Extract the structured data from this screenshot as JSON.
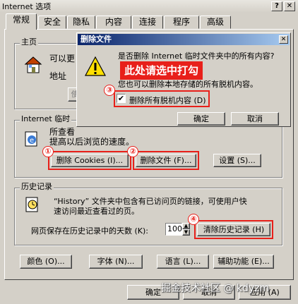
{
  "window": {
    "title": "Internet 选项",
    "help_glyph": "?",
    "close_glyph": "✕"
  },
  "tabs": [
    "常规",
    "安全",
    "隐私",
    "内容",
    "连接",
    "程序",
    "高级"
  ],
  "home": {
    "group_title": "主页",
    "desc": "可以更",
    "address_label": "地址",
    "btn_use_current": "使"
  },
  "temp_files": {
    "group_title": "Internet 临时",
    "desc_line1": "所查看",
    "desc_line2": "提高以后浏览的速度。",
    "btn_delete_cookies": "删除 Cookies (I)...",
    "btn_delete_files": "删除文件 (F)...",
    "btn_settings": "设置 (S)..."
  },
  "history": {
    "group_title": "历史记录",
    "desc_line1": "“History” 文件夹中包含有已访问页的链接，可使用户快",
    "desc_line2": "速访问最近查看过的页。",
    "days_label": "网页保存在历史记录中的天数 (K):",
    "days_value": "100",
    "btn_clear": "清除历史记录 (H)"
  },
  "bottom_buttons": [
    "颜色 (O)...",
    "字体 (N)...",
    "语言 (L)...",
    "辅助功能 (E)..."
  ],
  "footer": {
    "ok": "确定",
    "cancel": "取消",
    "apply": "应用 (A)"
  },
  "dialog": {
    "title": "删除文件",
    "close_glyph": "✕",
    "message_line1": "是否删除 Internet 临时文件夹中的所有内容?",
    "message_line2": "您也可以删除本地存储的所有脱机内容。",
    "checkbox_label": "删除所有脱机内容 (D)",
    "checkbox_checked": true,
    "ok": "确定",
    "cancel": "取消"
  },
  "annotations": {
    "callout_text": "此处请选中打勾",
    "markers": [
      "①",
      "②",
      "③",
      "④"
    ],
    "accent_color": "#e8201a"
  },
  "watermark": "掘金技术社区 @ kdyzm"
}
